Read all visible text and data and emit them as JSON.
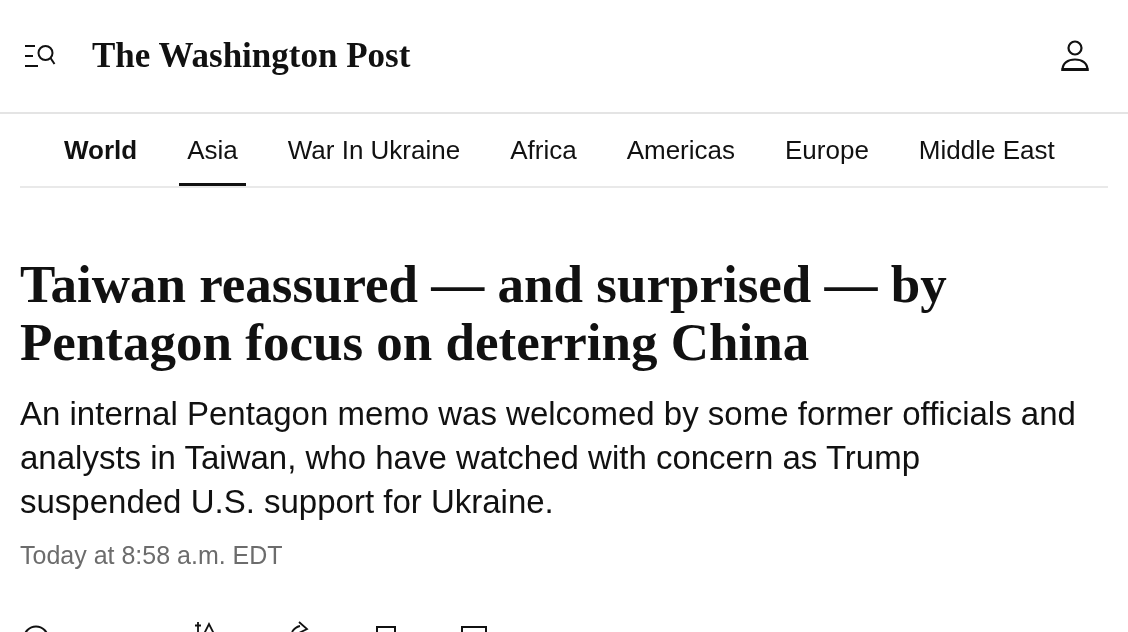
{
  "header": {
    "logo": "The Washington Post"
  },
  "nav": {
    "tabs": [
      {
        "label": "World",
        "kind": "section",
        "selected": false
      },
      {
        "label": "Asia",
        "kind": "link",
        "selected": true
      },
      {
        "label": "War In Ukraine",
        "kind": "link",
        "selected": false
      },
      {
        "label": "Africa",
        "kind": "link",
        "selected": false
      },
      {
        "label": "Americas",
        "kind": "link",
        "selected": false
      },
      {
        "label": "Europe",
        "kind": "link",
        "selected": false
      },
      {
        "label": "Middle East",
        "kind": "link",
        "selected": false
      }
    ]
  },
  "article": {
    "headline": "Taiwan reassured — and surprised — by Pentagon focus on deterring China",
    "dek": "An internal Pentagon memo was welcomed by some former officials and analysts in Taiwan, who have watched with concern as Trump suspended U.S. support for Ukraine.",
    "timestamp": "Today at 8:58 a.m. EDT"
  }
}
